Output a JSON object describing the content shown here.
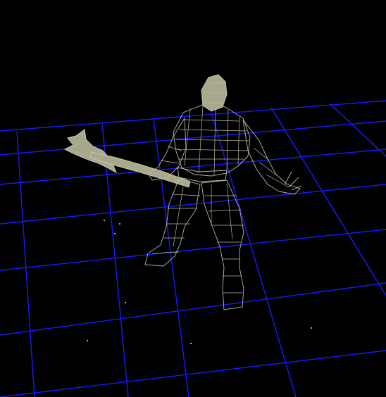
{
  "viewport": {
    "background_color": "#000000",
    "grid_color": "#1a1aff",
    "wireframe_color": "#c2c2a4",
    "model": "axe-warrior-wireframe",
    "render_mode": "wireframe"
  }
}
